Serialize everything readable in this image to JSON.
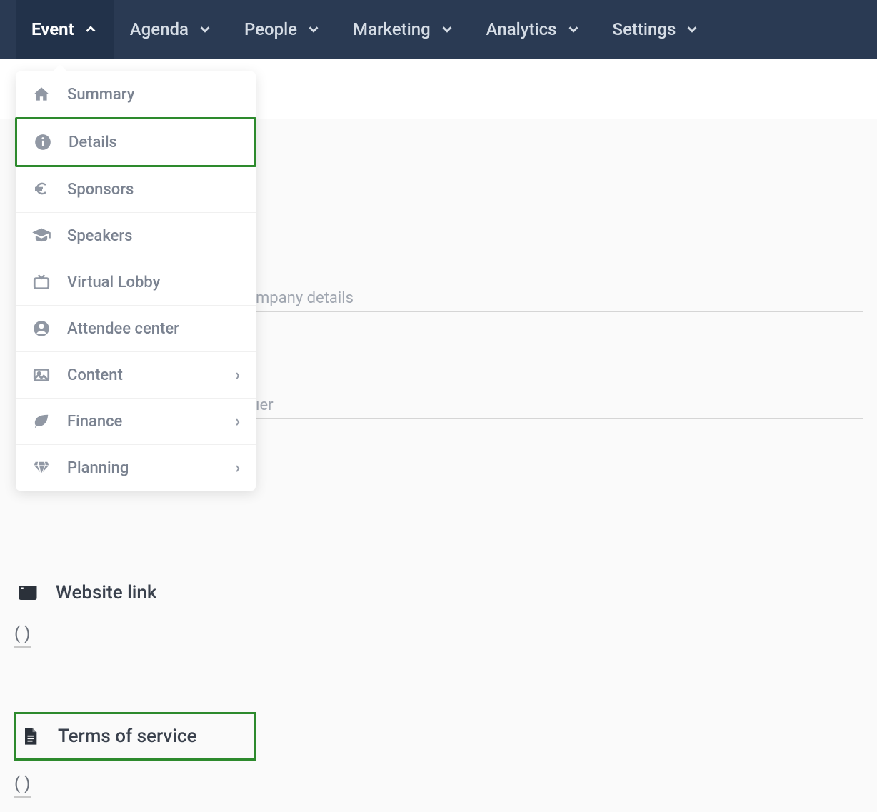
{
  "topnav": {
    "items": [
      {
        "label": "Event",
        "active": true,
        "chevron": "up"
      },
      {
        "label": "Agenda",
        "active": false,
        "chevron": "down"
      },
      {
        "label": "People",
        "active": false,
        "chevron": "down"
      },
      {
        "label": "Marketing",
        "active": false,
        "chevron": "down"
      },
      {
        "label": "Analytics",
        "active": false,
        "chevron": "down"
      },
      {
        "label": "Settings",
        "active": false,
        "chevron": "down"
      }
    ]
  },
  "dropdown": {
    "items": [
      {
        "icon": "home",
        "label": "Summary",
        "hasSubmenu": false,
        "highlighted": false
      },
      {
        "icon": "info",
        "label": "Details",
        "hasSubmenu": false,
        "highlighted": true
      },
      {
        "icon": "euro",
        "label": "Sponsors",
        "hasSubmenu": false,
        "highlighted": false
      },
      {
        "icon": "grad",
        "label": "Speakers",
        "hasSubmenu": false,
        "highlighted": false
      },
      {
        "icon": "tv",
        "label": "Virtual Lobby",
        "hasSubmenu": false,
        "highlighted": false
      },
      {
        "icon": "user",
        "label": "Attendee center",
        "hasSubmenu": false,
        "highlighted": false
      },
      {
        "icon": "image",
        "label": "Content",
        "hasSubmenu": true,
        "highlighted": false
      },
      {
        "icon": "leaf",
        "label": "Finance",
        "hasSubmenu": true,
        "highlighted": false
      },
      {
        "icon": "diamond",
        "label": "Planning",
        "hasSubmenu": true,
        "highlighted": false
      }
    ]
  },
  "fields": {
    "company_partial": "mpany details",
    "ner_partial": "ıer"
  },
  "sections": {
    "website": {
      "title": "Website link",
      "value": "( )"
    },
    "terms": {
      "title": "Terms of service",
      "value": "( )"
    }
  }
}
